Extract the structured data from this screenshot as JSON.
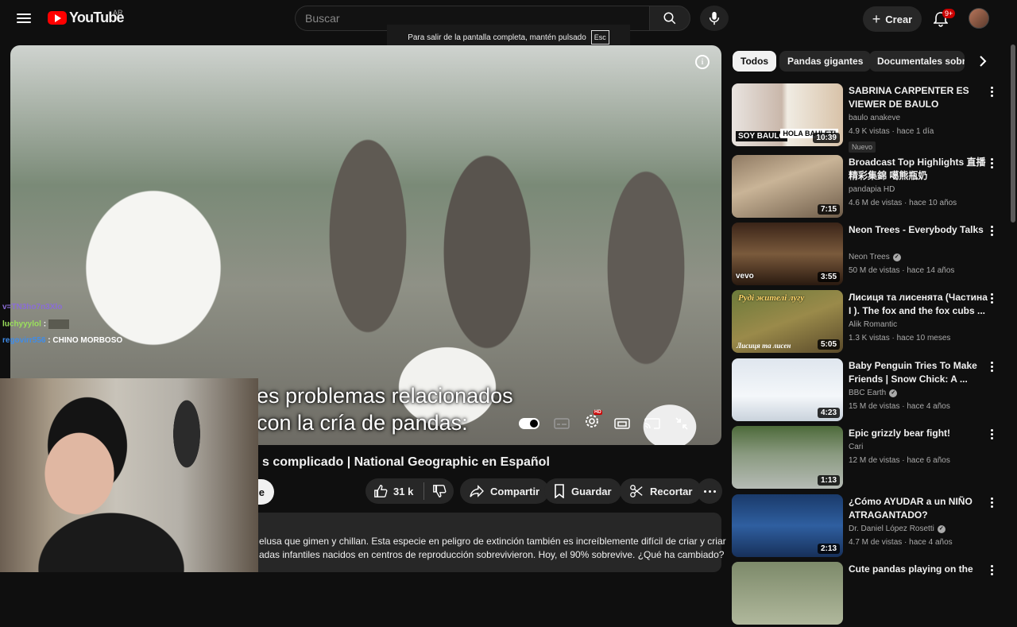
{
  "header": {
    "logo_text": "YouTube",
    "country_code": "AR",
    "search_placeholder": "Buscar",
    "create_label": "Crear",
    "notification_count": "9+"
  },
  "fullscreen_toast": {
    "message": "Para salir de la pantalla completa, mantén pulsado",
    "key": "Esc"
  },
  "player": {
    "subtitle_line1": "es problemas relacionados",
    "subtitle_line2": "con la cría de pandas:"
  },
  "chat": [
    {
      "user": "v=TN3ho7n3Xlo",
      "message": "",
      "color": "#8a6cd6"
    },
    {
      "user": "luchyyylol",
      "message": ":",
      "color": "#9be05b"
    },
    {
      "user": "regovirr556",
      "message": ": CHINO MORBOSO",
      "color": "#3f8ce8"
    }
  ],
  "video": {
    "title": "s complicado | National Geographic en Español",
    "subscribe_partial": "e",
    "likes": "31 k",
    "share_label": "Compartir",
    "save_label": "Guardar",
    "clip_label": "Recortar",
    "description_line1": "elusa que gimen y chillan. Esta especie en peligro de extinción también es increíblemente difícil de criar y criar",
    "description_line2": "adas infantiles nacidos en centros de reproducción sobrevivieron. Hoy, el 90% sobrevive. ¿Qué ha cambiado?"
  },
  "chips": [
    "Todos",
    "Pandas gigantes",
    "Documentales sobre"
  ],
  "recommendations": [
    {
      "title": "SABRINA CARPENTER ES VIEWER DE BAULO",
      "channel": "baulo anakeve",
      "verified": false,
      "meta": "4.9 K vistas · hace 1 día",
      "badge": "Nuevo",
      "duration": "10:39",
      "thumb_bg": "linear-gradient(90deg,#e9e4e0 0%,#c9b7aa 45%,#f0ece3 50%,#d8c2a8 100%)",
      "thumb_text": "SOY BAULO",
      "thumb_text2": "HOLA BAULETI"
    },
    {
      "title": "Broadcast Top Highlights 直播精彩集錦 噶熊瓶奶",
      "channel": "pandapia HD",
      "verified": false,
      "meta": "4.6 M de vistas · hace 10 años",
      "badge": "",
      "duration": "7:15",
      "thumb_bg": "linear-gradient(160deg,#8f7a63 0%,#c9b497 40%,#6e5c49 100%)",
      "thumb_text": "",
      "thumb_text2": ""
    },
    {
      "title": "Neon Trees - Everybody Talks",
      "channel": "Neon Trees",
      "verified": true,
      "meta": "50 M de vistas · hace 14 años",
      "badge": "",
      "duration": "3:55",
      "thumb_bg": "linear-gradient(180deg,#3a2418 0%,#7a5a3c 50%,#2a1a10 100%)",
      "thumb_text": "vevo",
      "thumb_text2": ""
    },
    {
      "title": "Лисиця та лисенята  (Частина I ).  The fox and the fox cubs ...",
      "channel": "Alik Romantic",
      "verified": false,
      "meta": "1.3 K vistas · hace 10 meses",
      "badge": "",
      "duration": "5:05",
      "thumb_bg": "linear-gradient(160deg,#6b7a3a 0%,#9a8a4a 50%,#5a4a2a 100%)",
      "thumb_text": "Руді жителі лугу",
      "thumb_text2": "Лисиця та лисен"
    },
    {
      "title": "Baby Penguin Tries To Make Friends | Snow Chick: A ...",
      "channel": "BBC Earth",
      "verified": true,
      "meta": "15 M de vistas · hace 4 años",
      "badge": "",
      "duration": "4:23",
      "thumb_bg": "linear-gradient(180deg,#dfe6ee 0%,#f4f7fa 60%,#c9d2dc 100%)",
      "thumb_text": "",
      "thumb_text2": ""
    },
    {
      "title": "Epic grizzly bear fight!",
      "channel": "Cari",
      "verified": false,
      "meta": "12 M de vistas · hace 6 años",
      "badge": "",
      "duration": "1:13",
      "thumb_bg": "linear-gradient(180deg,#4d6a3a 0%,#8a9a80 45%,#b5bbb5 100%)",
      "thumb_text": "",
      "thumb_text2": ""
    },
    {
      "title": "¿Cómo AYUDAR a un NIÑO ATRAGANTADO?",
      "channel": "Dr. Daniel López Rosetti",
      "verified": true,
      "meta": "4.7 M de vistas · hace 4 años",
      "badge": "",
      "duration": "2:13",
      "thumb_bg": "linear-gradient(180deg,#1a3a6a 0%,#2f5fa0 50%,#17305a 100%)",
      "thumb_text": "",
      "thumb_text2": ""
    },
    {
      "title": "Cute pandas playing on the",
      "channel": "",
      "verified": false,
      "meta": "",
      "badge": "",
      "duration": "",
      "thumb_bg": "linear-gradient(180deg,#7d8a6a 0%,#b0b89c 100%)",
      "thumb_text": "",
      "thumb_text2": ""
    }
  ]
}
